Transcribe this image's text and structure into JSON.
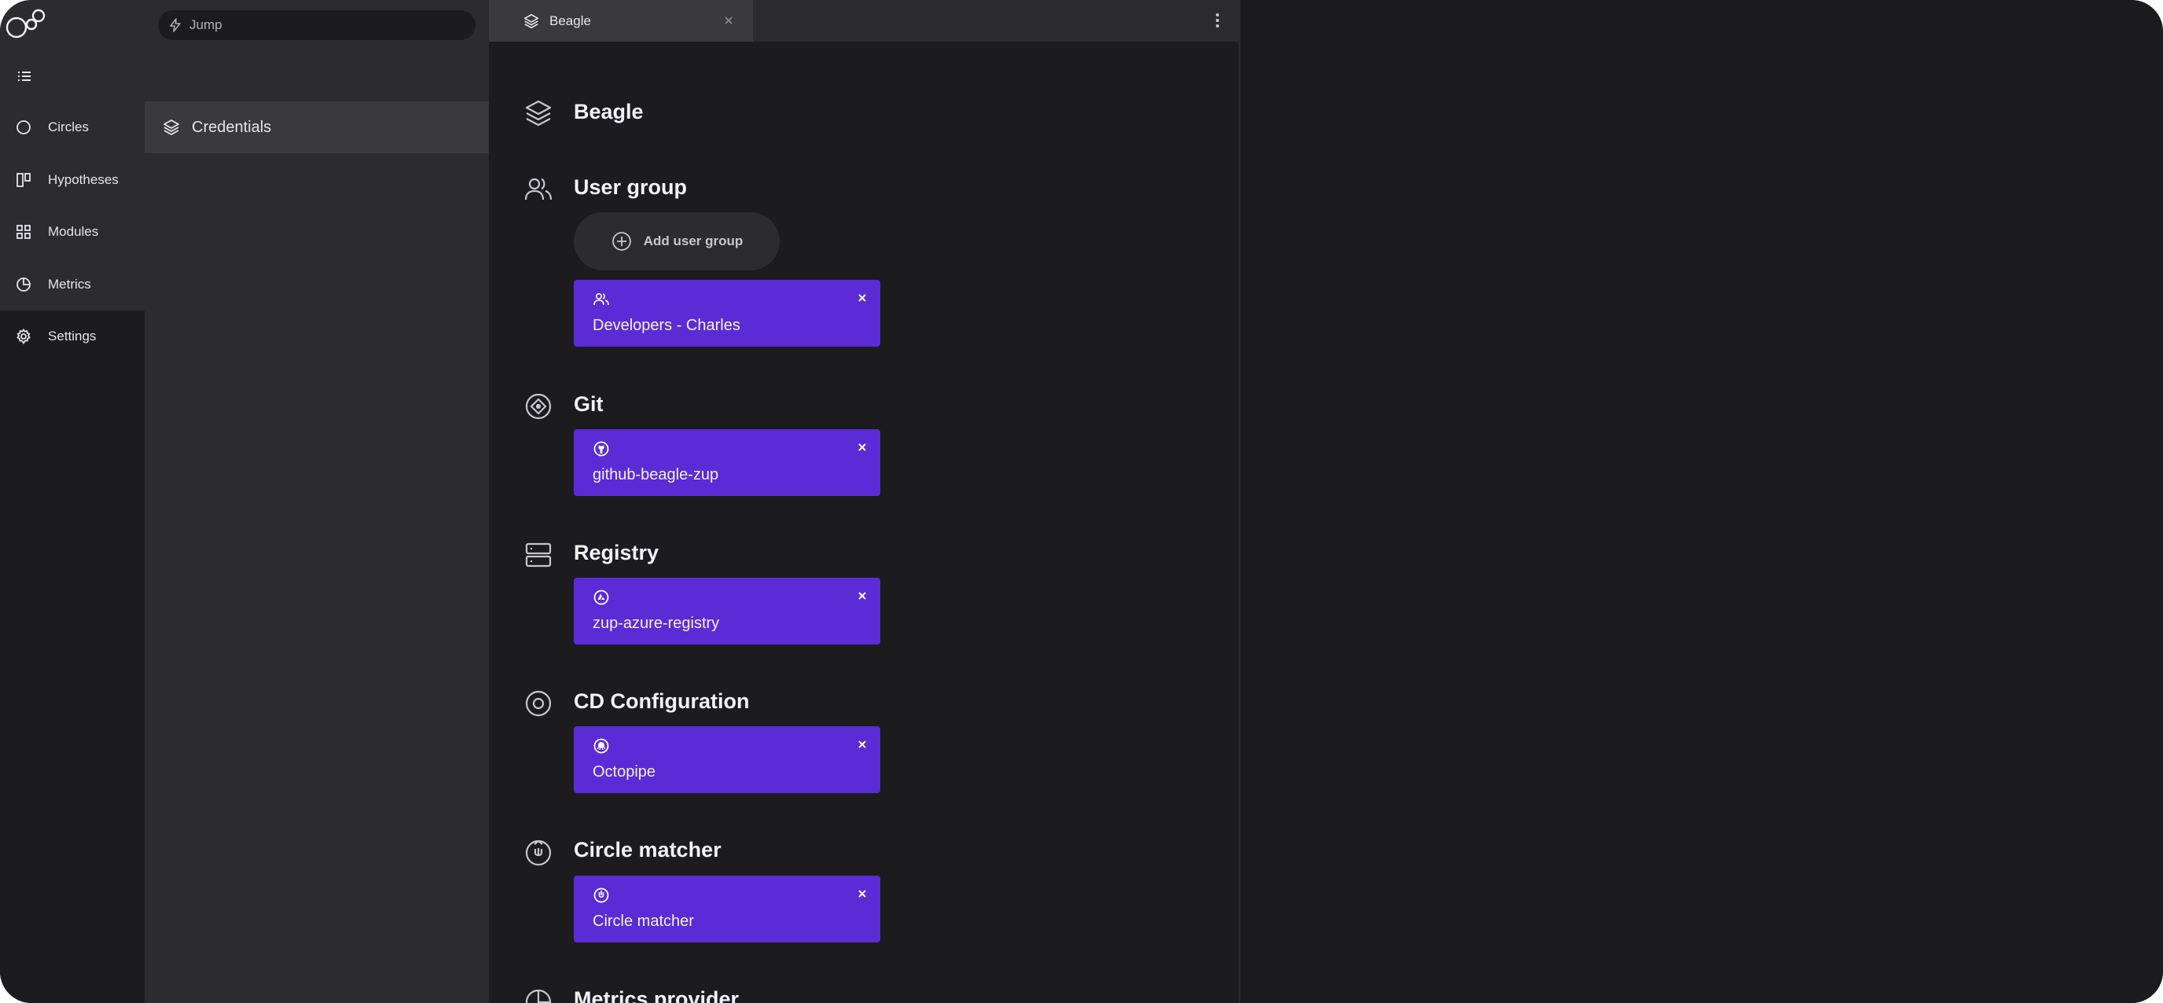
{
  "nav": {
    "items": [
      {
        "label": "Circles",
        "icon": "circle-icon"
      },
      {
        "label": "Hypotheses",
        "icon": "board-icon"
      },
      {
        "label": "Modules",
        "icon": "grid-icon"
      },
      {
        "label": "Metrics",
        "icon": "pie-chart-icon"
      },
      {
        "label": "Settings",
        "icon": "gear-icon",
        "active": true
      }
    ]
  },
  "search": {
    "placeholder": "Jump"
  },
  "list": {
    "items": [
      {
        "label": "Credentials",
        "icon": "layers-icon"
      }
    ]
  },
  "tab": {
    "label": "Beagle"
  },
  "content": {
    "workspace_title": "Beagle",
    "sections": [
      {
        "title": "User group",
        "add_button": "Add user group",
        "card": {
          "label": "Developers - Charles",
          "icon": "users-icon"
        }
      },
      {
        "title": "Git",
        "card": {
          "label": "github-beagle-zup",
          "icon": "github-icon"
        }
      },
      {
        "title": "Registry",
        "card": {
          "label": "zup-azure-registry",
          "icon": "azure-icon"
        }
      },
      {
        "title": "CD Configuration",
        "card": {
          "label": "Octopipe",
          "icon": "octopipe-icon"
        }
      },
      {
        "title": "Circle matcher",
        "card": {
          "label": "Circle matcher",
          "icon": "circle-matcher-icon"
        }
      },
      {
        "title": "Metrics provider"
      }
    ]
  },
  "colors": {
    "background": "#1c1c1e",
    "panel": "#2c2c2e",
    "selected": "#3a3a3c",
    "accent": "#5b2bd6"
  }
}
